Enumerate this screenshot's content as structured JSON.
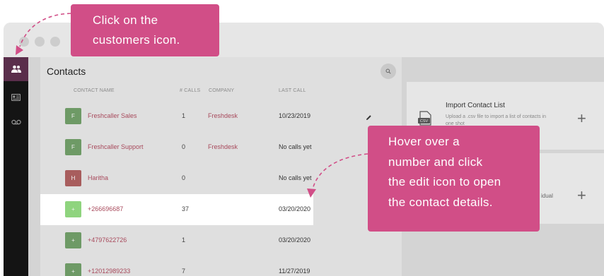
{
  "sidebar": {
    "items": [
      {
        "icon": "customers-icon",
        "active": true
      },
      {
        "icon": "contact-card-icon",
        "active": false
      },
      {
        "icon": "voicemail-icon",
        "active": false
      }
    ]
  },
  "contacts": {
    "title": "Contacts",
    "columns": {
      "name": "CONTACT NAME",
      "calls": "# CALLS",
      "company": "COMPANY",
      "last_call": "LAST CALL"
    },
    "rows": [
      {
        "initial": "F",
        "name": "Freshcaller Sales",
        "calls": "1",
        "company": "Freshdesk",
        "last_call": "10/23/2019",
        "avatar_color": "#6e9a66"
      },
      {
        "initial": "F",
        "name": "Freshcaller Support",
        "calls": "0",
        "company": "Freshdesk",
        "last_call": "No calls yet",
        "avatar_color": "#6e9a66"
      },
      {
        "initial": "H",
        "name": "Haritha",
        "calls": "0",
        "company": "",
        "last_call": "No calls yet",
        "avatar_color": "#a85d5d"
      },
      {
        "initial": "+",
        "name": "+266696687",
        "calls": "37",
        "company": "",
        "last_call": "03/20/2020",
        "avatar_color": "#8fd47e"
      },
      {
        "initial": "+",
        "name": "+4797622726",
        "calls": "1",
        "company": "",
        "last_call": "03/20/2020",
        "avatar_color": "#6e9a66"
      },
      {
        "initial": "+",
        "name": "+12012989233",
        "calls": "7",
        "company": "",
        "last_call": "11/27/2019",
        "avatar_color": "#6e9a66"
      }
    ]
  },
  "import_card": {
    "title": "Import Contact List",
    "description": "Upload a .csv file to import a list of contacts in one shot",
    "badge": "CSV"
  },
  "add_card": {
    "partial_text": "idual"
  },
  "tooltips": {
    "customers": [
      "Click on the",
      "customers icon."
    ],
    "edit": [
      "Hover over a",
      "number and  click",
      "the edit icon to open",
      "the contact details."
    ]
  },
  "colors": {
    "tooltip": "#d14e87",
    "rail": "#141414",
    "active_rail": "#5a2e4b",
    "link": "#a84a5c"
  }
}
